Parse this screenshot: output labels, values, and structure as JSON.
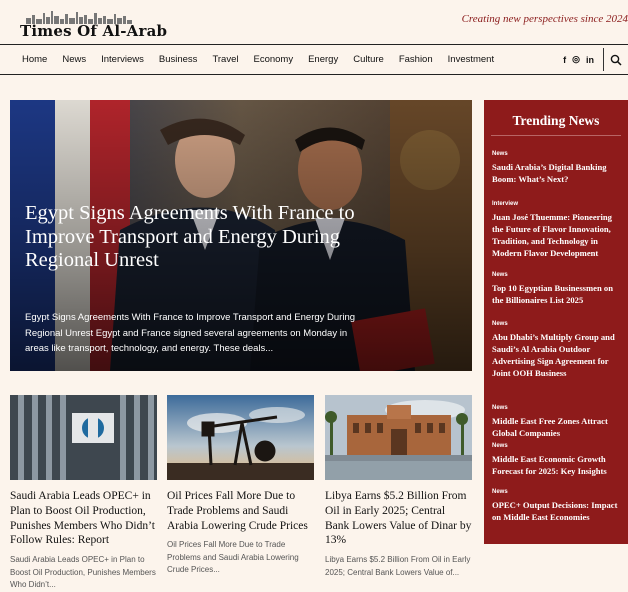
{
  "site": {
    "logo_text": "Times Of Al-Arab",
    "tagline": "Creating new perspectives since 2024"
  },
  "nav": {
    "items": [
      "Home",
      "News",
      "Interviews",
      "Business",
      "Travel",
      "Economy",
      "Energy",
      "Culture",
      "Fashion",
      "Investment"
    ],
    "social": [
      "facebook-icon",
      "instagram-icon",
      "linkedin-icon"
    ],
    "social_glyphs": [
      "f",
      "◎",
      "in"
    ]
  },
  "hero": {
    "title": "Egypt Signs Agreements With France to Improve Transport and Energy During Regional Unrest",
    "excerpt": "Egypt Signs Agreements With France to Improve Transport and Energy During Regional Unrest Egypt and France signed several agreements on Monday in areas like transport, technology, and energy. These deals..."
  },
  "cards": [
    {
      "title": "Saudi Arabia Leads OPEC+ in Plan to Boost Oil Production, Punishes Members Who Didn’t Follow Rules: Report",
      "excerpt": "Saudi Arabia Leads OPEC+ in Plan to Boost Oil Production, Punishes Members Who Didn’t..."
    },
    {
      "title": "Oil Prices Fall More Due to Trade Problems and Saudi Arabia Lowering Crude Prices",
      "excerpt": "Oil Prices Fall More Due to Trade Problems and Saudi Arabia Lowering Crude Prices..."
    },
    {
      "title": "Libya Earns $5.2 Billion From Oil in Early 2025; Central Bank Lowers Value of Dinar by 13%",
      "excerpt": "Libya Earns $5.2 Billion From Oil in Early 2025; Central Bank Lowers Value of..."
    }
  ],
  "trending": {
    "heading": "Trending News",
    "items": [
      {
        "category": "News",
        "title": "Saudi Arabia’s Digital Banking Boom: What’s Next?"
      },
      {
        "category": "Interview",
        "title": "Juan José Thuemme: Pioneering the Future of Flavor Innovation, Tradition, and Technology in Modern Flavor Development"
      },
      {
        "category": "News",
        "title": "Top 10 Egyptian Businessmen on the Billionaires List 2025"
      },
      {
        "category": "News",
        "title": "Abu Dhabi’s Multiply Group and Saudi’s Al Arabia Outdoor Advertising Sign Agreement for Joint OOH Business"
      },
      {
        "category": "News",
        "title": "Middle East Free Zones Attract Global Companies"
      },
      {
        "category": "News",
        "title": "Middle East Economic Growth Forecast for 2025: Key Insights"
      },
      {
        "category": "News",
        "title": "OPEC+ Output Decisions: Impact on Middle East Economies"
      }
    ]
  },
  "colors": {
    "background": "#fcf4ec",
    "accent": "#8e1b1b",
    "tagline": "#8b1c1c"
  }
}
